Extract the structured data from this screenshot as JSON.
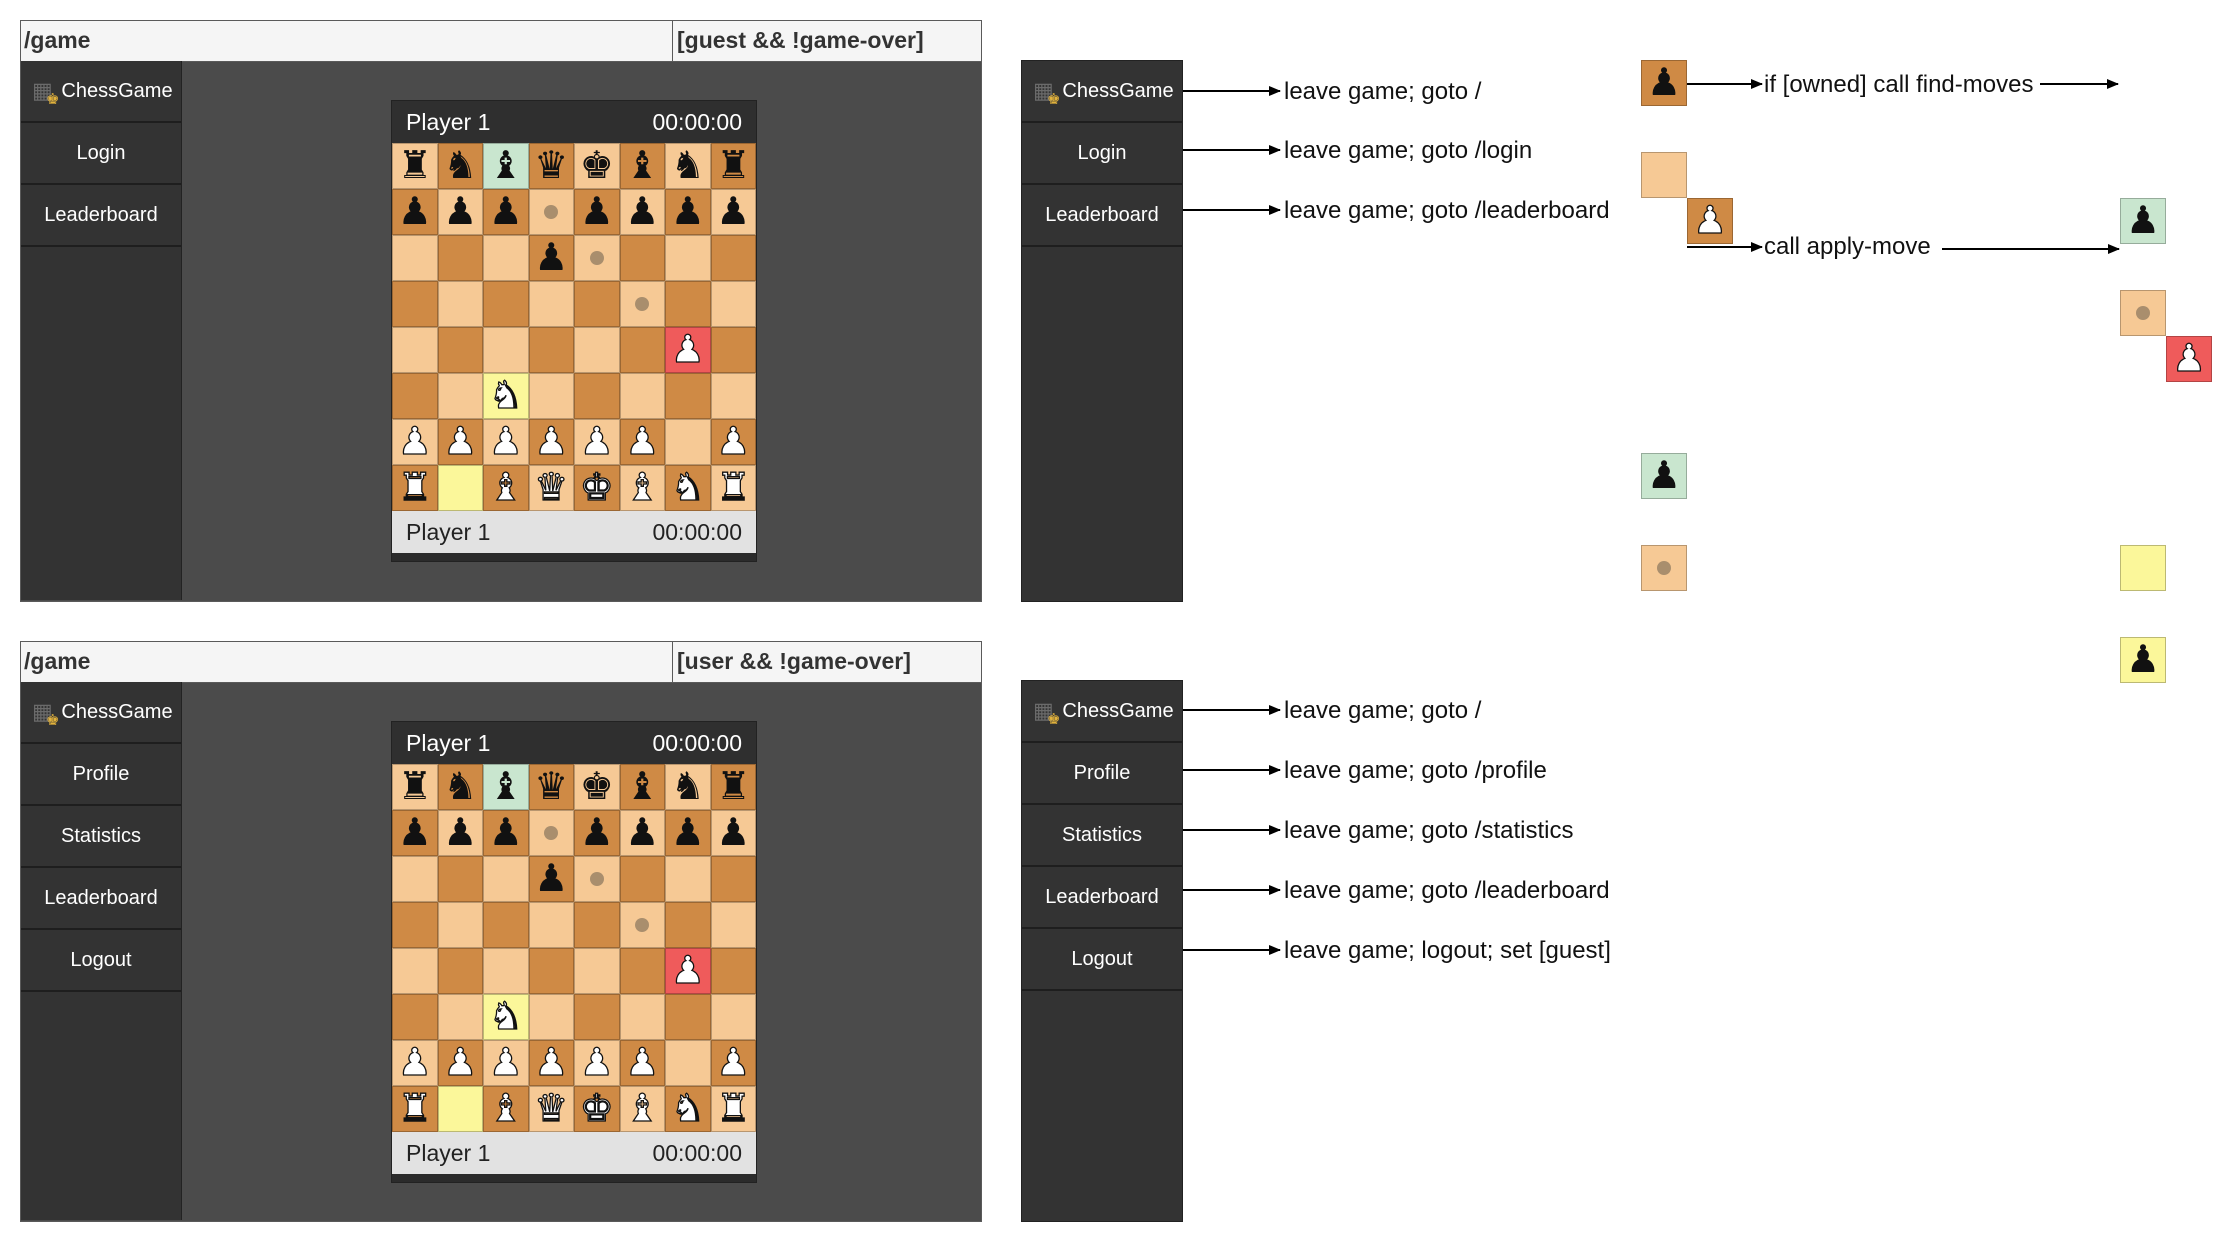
{
  "panels": [
    {
      "route": "/game",
      "condition": "[guest && !game-over]",
      "sidebar": [
        {
          "label": "ChessGame",
          "icon": "chessboard-logo-icon",
          "action": "leave game; goto /"
        },
        {
          "label": "Login",
          "action": "leave game; goto /login"
        },
        {
          "label": "Leaderboard",
          "action": "leave game; goto /leaderboard"
        }
      ],
      "board": {
        "top_player": "Player 1",
        "top_time": "00:00:00",
        "bottom_player": "Player 1",
        "bottom_time": "00:00:00"
      }
    },
    {
      "route": "/game",
      "condition": "[user && !game-over]",
      "sidebar": [
        {
          "label": "ChessGame",
          "icon": "chessboard-logo-icon",
          "action": "leave game; goto /"
        },
        {
          "label": "Profile",
          "action": "leave game; goto /profile"
        },
        {
          "label": "Statistics",
          "action": "leave game; goto /statistics"
        },
        {
          "label": "Leaderboard",
          "action": "leave game; goto /leaderboard"
        },
        {
          "label": "Logout",
          "action": "leave game; logout; set [guest]"
        }
      ],
      "board": {
        "top_player": "Player 1",
        "top_time": "00:00:00",
        "bottom_player": "Player 1",
        "bottom_time": "00:00:00"
      }
    }
  ],
  "board_position": {
    "ranks": [
      [
        "br",
        "bn",
        "bb",
        "bq",
        "bk",
        "bb",
        "bn",
        "br"
      ],
      [
        "bp",
        "bp",
        "bp",
        "",
        "bp",
        "bp",
        "bp",
        "bp"
      ],
      [
        "",
        "",
        "",
        "bp",
        "",
        "",
        "",
        ""
      ],
      [
        "",
        "",
        "",
        "",
        "",
        "",
        "",
        ""
      ],
      [
        "",
        "",
        "",
        "",
        "",
        "",
        "wp",
        ""
      ],
      [
        "",
        "",
        "wn",
        "",
        "",
        "",
        "",
        ""
      ],
      [
        "wp",
        "wp",
        "wp",
        "wp",
        "wp",
        "wp",
        "",
        "wp"
      ],
      [
        "wr",
        "",
        "wb",
        "wq",
        "wk",
        "wb",
        "wn",
        "wr"
      ]
    ],
    "selected": [
      [
        0,
        2
      ]
    ],
    "move_dots": [
      [
        1,
        3
      ],
      [
        2,
        4
      ],
      [
        3,
        5
      ]
    ],
    "last_move": [
      [
        7,
        1
      ],
      [
        5,
        2
      ]
    ],
    "attacked": [
      [
        4,
        6
      ]
    ]
  },
  "legend": {
    "find_moves_label": "if [owned] call find-moves",
    "apply_move_label": "call apply-move"
  },
  "colors": {
    "light_square": "#f6c995",
    "dark_square": "#cf8a45",
    "selected_square": "#c9e6cf",
    "last_move_square": "#fbf79a",
    "attacked_square": "#ef5b5b",
    "sidebar_bg": "#333333",
    "frame_bg": "#4b4b4b"
  }
}
